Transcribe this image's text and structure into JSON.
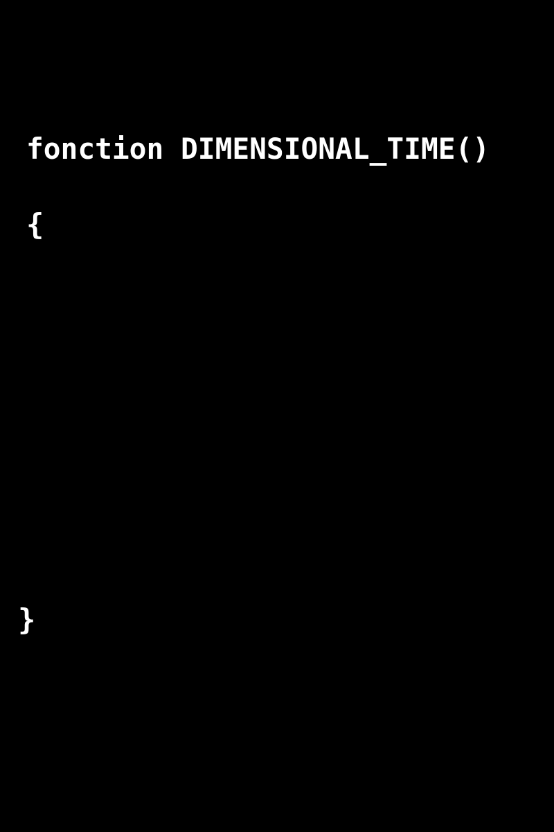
{
  "code": {
    "signature": "fonction DIMENSIONAL_TIME()",
    "open_brace": "{",
    "close_brace": "}"
  },
  "colors": {
    "background": "#000000",
    "text": "#ffffff"
  }
}
